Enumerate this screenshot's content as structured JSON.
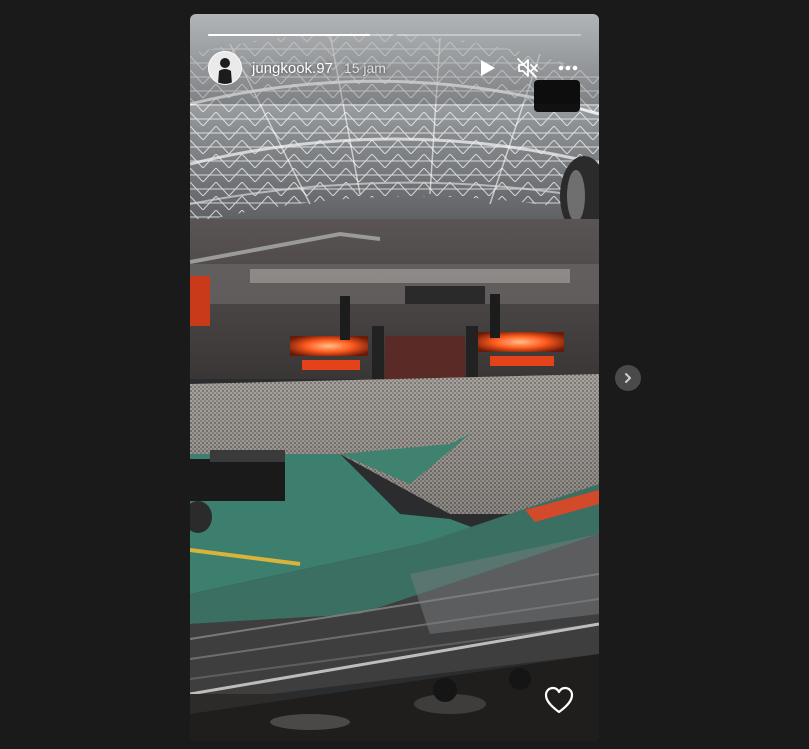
{
  "story": {
    "username": "jungkook.97",
    "time_ago": "15 jam",
    "progress": [
      {
        "fill": 0.88
      },
      {
        "fill": 0
      }
    ],
    "media": {
      "description_icon": "stadium-concert-photo"
    }
  },
  "icons": {
    "play": "play-icon",
    "mute": "muted-speaker-icon",
    "more": "more-horizontal-icon",
    "next": "chevron-right-icon",
    "like": "heart-icon"
  },
  "colors": {
    "page_background": "#1a1a1a",
    "stage_glow": "#ff5a1e",
    "floor": "#3d7f6e",
    "white": "#ffffff"
  }
}
